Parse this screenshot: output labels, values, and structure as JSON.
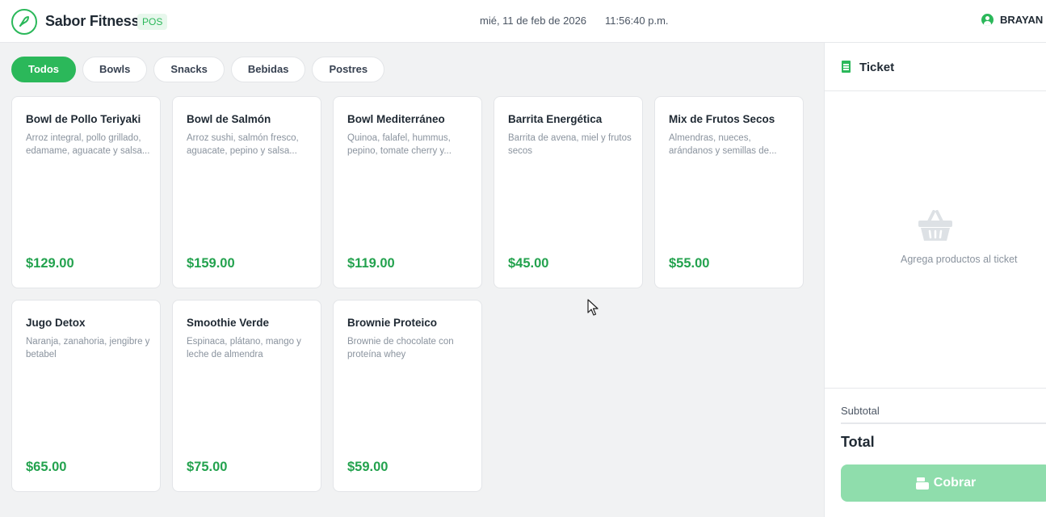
{
  "header": {
    "brand": "Sabor Fitness",
    "badge": "POS",
    "date": "mié, 11 de feb de 2026",
    "time": "11:56:40 p.m.",
    "user": "BRAYAN"
  },
  "categories": [
    {
      "label": "Todos",
      "active": true
    },
    {
      "label": "Bowls",
      "active": false
    },
    {
      "label": "Snacks",
      "active": false
    },
    {
      "label": "Bebidas",
      "active": false
    },
    {
      "label": "Postres",
      "active": false
    }
  ],
  "products": [
    {
      "name": "Bowl de Pollo Teriyaki",
      "description": "Arroz integral, pollo grillado, edamame, aguacate y salsa...",
      "price": "$129.00"
    },
    {
      "name": "Bowl de Salmón",
      "description": "Arroz sushi, salmón fresco, aguacate, pepino y salsa...",
      "price": "$159.00"
    },
    {
      "name": "Bowl Mediterráneo",
      "description": "Quinoa, falafel, hummus, pepino, tomate cherry y...",
      "price": "$119.00"
    },
    {
      "name": "Barrita Energética",
      "description": "Barrita de avena, miel y frutos secos",
      "price": "$45.00"
    },
    {
      "name": "Mix de Frutos Secos",
      "description": "Almendras, nueces, arándanos y semillas de...",
      "price": "$55.00"
    },
    {
      "name": "Jugo Detox",
      "description": "Naranja, zanahoria, jengibre y betabel",
      "price": "$65.00"
    },
    {
      "name": "Smoothie Verde",
      "description": "Espinaca, plátano, mango y leche de almendra",
      "price": "$75.00"
    },
    {
      "name": "Brownie Proteico",
      "description": "Brownie de chocolate con proteína whey",
      "price": "$59.00"
    }
  ],
  "ticket": {
    "title": "Ticket",
    "empty_message": "Agrega productos al ticket",
    "subtotal_label": "Subtotal",
    "total_label": "Total",
    "charge_button": "Cobrar"
  },
  "colors": {
    "accent": "#2bb85a",
    "price": "#23a24e",
    "button_disabled": "#8fddac"
  }
}
